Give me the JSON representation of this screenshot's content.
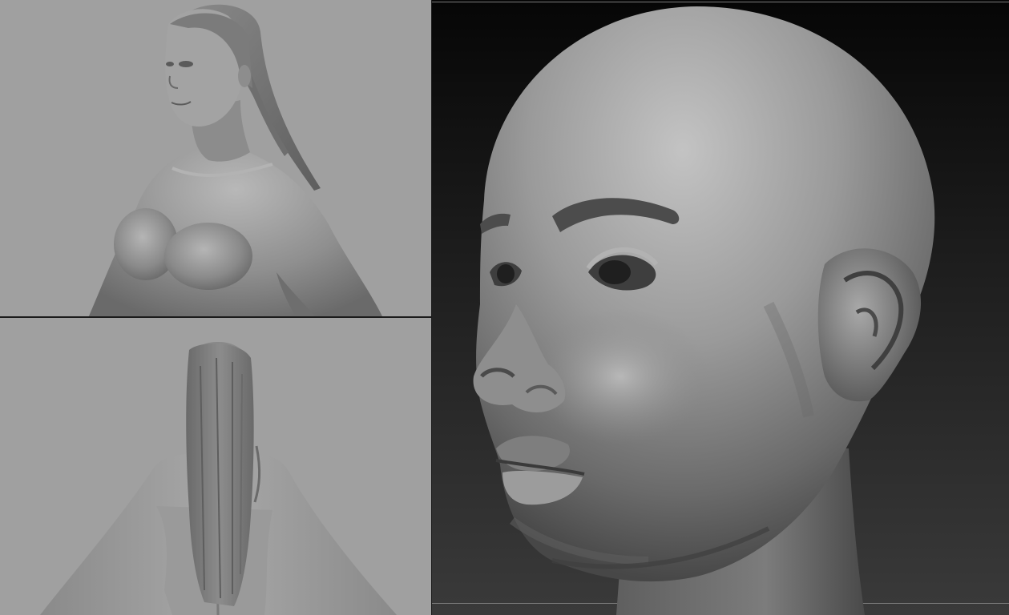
{
  "panels": {
    "front_view": {
      "background": "#a0a0a0",
      "subject": "female-torso-3-4-front",
      "material": "gray-matcap"
    },
    "back_view": {
      "background": "#a0a0a0",
      "subject": "female-back-with-long-hair",
      "material": "gray-matcap"
    },
    "head_view": {
      "background_top": "#060606",
      "background_bottom": "#3a3a3a",
      "subject": "sculpted-head-closeup",
      "material": "gray-clay"
    }
  },
  "colors": {
    "skin": "#9c9c9c",
    "skin_highlight": "#c4c4c4",
    "skin_shadow": "#606060",
    "hair": "#7d7d7d"
  }
}
